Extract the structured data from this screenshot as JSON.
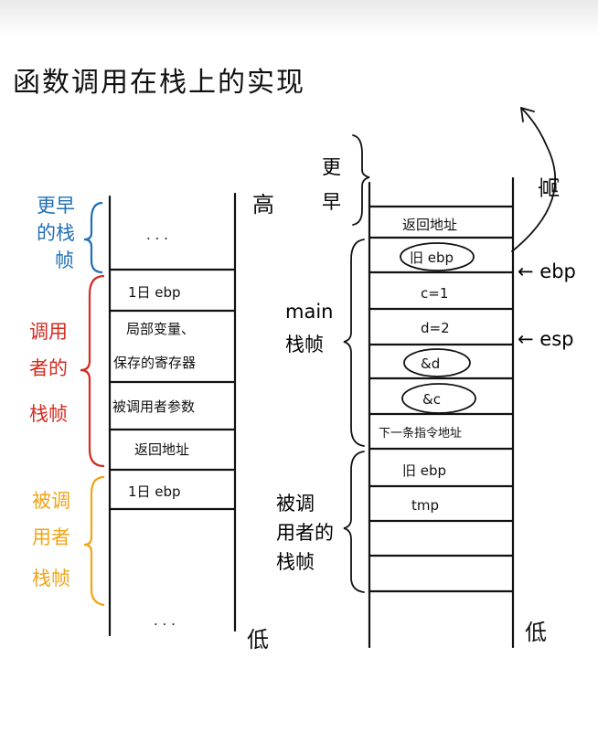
{
  "title": "函数调用在栈上的实现",
  "left_stack": {
    "top_dots": ". . .",
    "bottom_dots": ". . .",
    "cells": [
      "1日 ebp",
      "局部变量、",
      "保存的寄存器",
      "被调用者参数",
      "返回地址",
      "1日 ebp"
    ],
    "high_label": "高",
    "low_label": "低"
  },
  "left_labels": {
    "earlier_frame": [
      "更早",
      "的栈",
      "帧"
    ],
    "caller_frame": [
      "调用",
      "者的",
      "栈帧"
    ],
    "callee_frame": [
      "被调",
      "用者",
      "栈帧"
    ]
  },
  "right_stack": {
    "cells": [
      "返回地址",
      "旧 ebp",
      "c=1",
      "d=2",
      "&d",
      "&c",
      "下一条指令地址",
      "旧 ebp",
      "tmp",
      "",
      "",
      ""
    ],
    "high_label": "高",
    "low_label": "低",
    "ebp_marker": "← ebp",
    "esp_marker": "← esp"
  },
  "right_labels": {
    "earlier": [
      "更",
      "早"
    ],
    "main_frame": [
      "main",
      "栈帧"
    ],
    "callee_frame": [
      "被调",
      "用者的",
      "栈帧"
    ]
  },
  "colors": {
    "blue": "#1f6fb5",
    "red": "#d42a1e",
    "orange": "#f0a418",
    "ink": "#111111"
  }
}
